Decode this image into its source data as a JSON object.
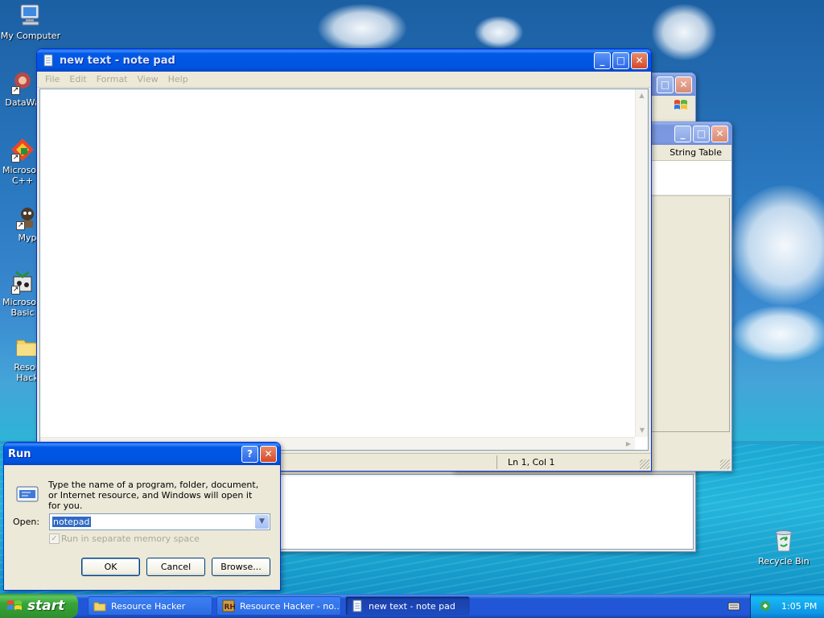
{
  "desktop": {
    "icons": [
      {
        "label": "My Computer",
        "icon": "my-computer-icon"
      },
      {
        "label": "DataWa",
        "icon": "datawarehouse-shortcut-icon"
      },
      {
        "label": "Microsoft C++",
        "icon": "visual-cpp-shortcut-icon"
      },
      {
        "label": "Myp",
        "icon": "myp-shortcut-icon"
      },
      {
        "label": "Microsoft Basic",
        "icon": "visual-basic-shortcut-icon"
      },
      {
        "label": "Resou Hack",
        "icon": "folder-icon"
      },
      {
        "label": "Recycle Bin",
        "icon": "recycle-bin-icon"
      }
    ]
  },
  "notepad": {
    "title": "new text - note pad",
    "menu": [
      "File",
      "Edit",
      "Format",
      "View",
      "Help"
    ],
    "content": "",
    "status_position": "Ln 1, Col 1"
  },
  "resource_hacker": {
    "column_header": "String Table"
  },
  "run_dialog": {
    "title": "Run",
    "description": "Type the name of a program, folder, document, or Internet resource, and Windows will open it for you.",
    "open_label": "Open:",
    "open_value": "notepad",
    "separate_memory_label": "Run in separate memory space",
    "ok_label": "OK",
    "cancel_label": "Cancel",
    "browse_label": "Browse..."
  },
  "taskbar": {
    "start_label": "start",
    "buttons": [
      {
        "label": "Resource Hacker",
        "icon": "folder-icon"
      },
      {
        "label": "Resource Hacker - no...",
        "icon": "resource-hacker-icon"
      },
      {
        "label": "new text - note pad",
        "icon": "notepad-icon"
      }
    ],
    "clock": "1:05 PM"
  },
  "colors": {
    "xp_blue": "#0055e0",
    "taskbar": "#2157d7",
    "start_green": "#37a537",
    "window_face": "#ece9d8"
  }
}
